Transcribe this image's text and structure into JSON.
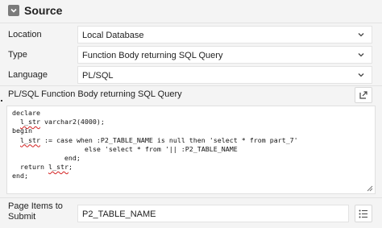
{
  "section": {
    "title": "Source",
    "collapse_icon": "chevron-down-icon"
  },
  "fields": {
    "location": {
      "label": "Location",
      "value": "Local Database"
    },
    "type": {
      "label": "Type",
      "value": "Function Body returning SQL Query"
    },
    "language": {
      "label": "Language",
      "value": "PL/SQL"
    }
  },
  "code": {
    "label": "PL/SQL Function Body returning SQL Query",
    "lines": {
      "l1": "declare",
      "l2_pre": "  ",
      "l2_var": "l_str",
      "l2_post": " varchar2(4000);",
      "l3": "begin",
      "l4_pre": "  ",
      "l4_var": "l_str",
      "l4_post": " := case when :P2_TABLE_NAME is null then 'select * from part_7'",
      "l5": "                  else 'select * from '|| :P2_TABLE_NAME",
      "l6": "             end;",
      "l7_pre": "  return ",
      "l7_var": "l_str",
      "l7_post": ";",
      "l8": "end;"
    },
    "expand_icon": "expand-icon",
    "resize_icon": "resize-handle-icon"
  },
  "page_items": {
    "label_line1": "Page Items to",
    "label_line2": "Submit",
    "value": "P2_TABLE_NAME",
    "list_icon": "list-icon"
  }
}
